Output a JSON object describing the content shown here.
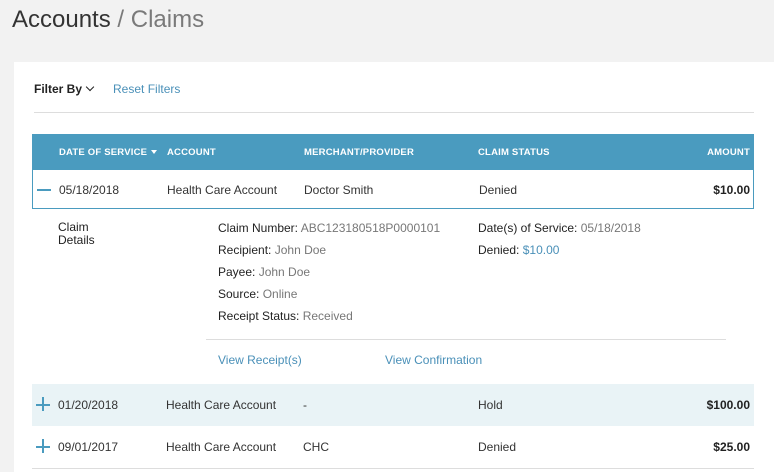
{
  "header": {
    "crumb1": "Accounts",
    "separator": "/",
    "crumb2": "Claims"
  },
  "filters": {
    "filter_by_label": "Filter By",
    "reset_label": "Reset Filters"
  },
  "table": {
    "columns": {
      "date": "DATE OF SERVICE",
      "account": "ACCOUNT",
      "merchant": "MERCHANT/PROVIDER",
      "status": "CLAIM STATUS",
      "amount": "AMOUNT"
    },
    "rows": [
      {
        "date": "05/18/2018",
        "account": "Health Care Account",
        "merchant": "Doctor Smith",
        "status": "Denied",
        "amount": "$10.00",
        "expanded": true
      },
      {
        "date": "01/20/2018",
        "account": "Health Care Account",
        "merchant": "-",
        "status": "Hold",
        "amount": "$100.00",
        "expanded": false
      },
      {
        "date": "09/01/2017",
        "account": "Health Care Account",
        "merchant": "CHC",
        "status": "Denied",
        "amount": "$25.00",
        "expanded": false
      }
    ]
  },
  "details": {
    "section_label_1": "Claim",
    "section_label_2": "Details",
    "claim_number_label": "Claim Number:",
    "claim_number": "ABC123180518P0000101",
    "recipient_label": "Recipient:",
    "recipient": "John Doe",
    "payee_label": "Payee:",
    "payee": "John Doe",
    "source_label": "Source:",
    "source": "Online",
    "receipt_status_label": "Receipt Status:",
    "receipt_status": "Received",
    "dates_label": "Date(s) of Service:",
    "dates": "05/18/2018",
    "denied_label": "Denied:",
    "denied_amount": "$10.00",
    "view_receipts": "View Receipt(s)",
    "view_confirmation": "View Confirmation"
  },
  "colors": {
    "accent": "#4a9bbf",
    "link": "#4a90b8",
    "row_tint": "#e9f3f6"
  }
}
